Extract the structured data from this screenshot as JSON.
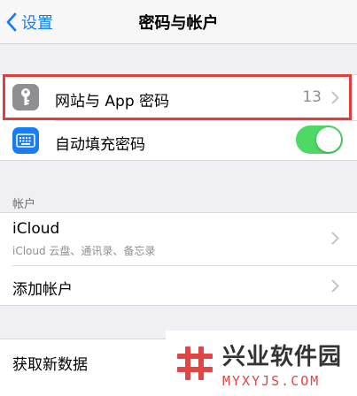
{
  "navbar": {
    "back_label": "设置",
    "title": "密码与帐户"
  },
  "passwords_group": {
    "website_passwords": {
      "label": "网站与 App 密码",
      "value": "13",
      "icon": "key-icon",
      "icon_color": "#8e8e93"
    },
    "autofill": {
      "label": "自动填充密码",
      "icon": "keyboard-icon",
      "icon_color": "#1a7cf5",
      "toggle_on": true,
      "toggle_color": "#4cd964"
    }
  },
  "accounts_section": {
    "header": "帐户",
    "icloud": {
      "label": "iCloud",
      "subtitle": "iCloud 云盘、通讯录、备忘录"
    },
    "add_account": {
      "label": "添加帐户"
    }
  },
  "fetch_group": {
    "fetch_new_data": {
      "label": "获取新数据"
    }
  },
  "watermark": {
    "name": "兴业软件园",
    "domain": "MYXYJS.COM",
    "accent_color": "#e04646"
  },
  "highlight_color": "#e23c3c"
}
